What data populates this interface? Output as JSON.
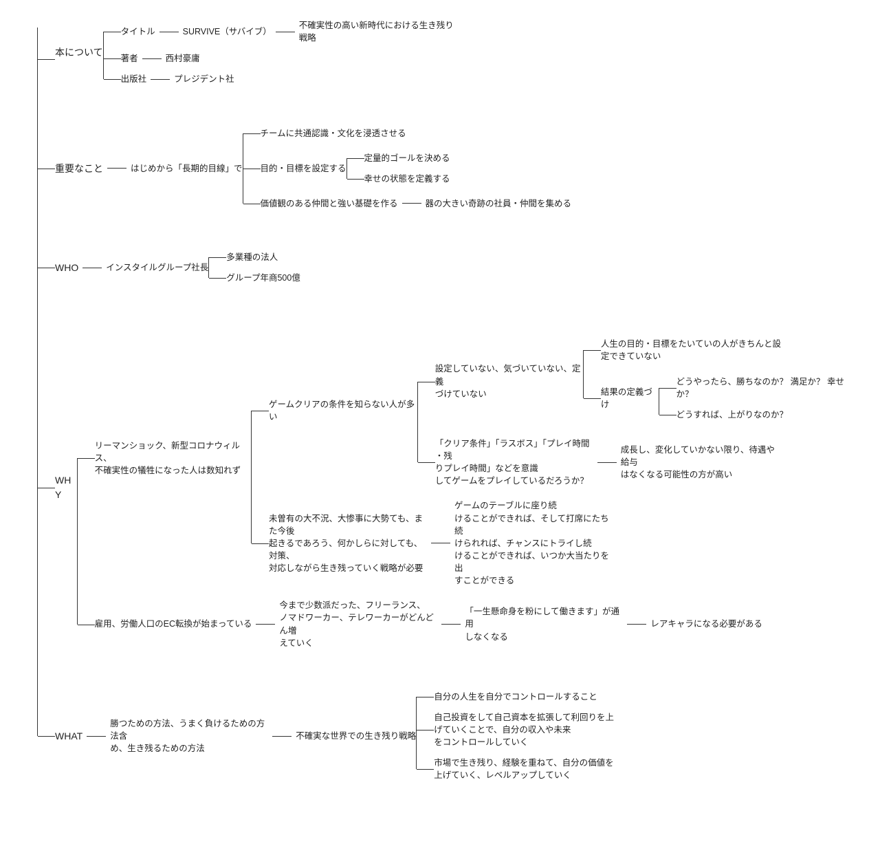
{
  "about": {
    "label": "本について",
    "title": {
      "k": "タイトル",
      "v": "SURVIVE（サバイブ）",
      "sub": "不確実性の高い新時代における生き残り戦略"
    },
    "author": {
      "k": "著者",
      "v": "西村豪庸"
    },
    "publisher": {
      "k": "出版社",
      "v": "プレジデント社"
    }
  },
  "important": {
    "label": "重要なこと",
    "stem": "はじめから「長期的目線」で",
    "a": "チームに共通認識・文化を浸透させる",
    "b": {
      "label": "目的・目標を設定する",
      "b1": "定量的ゴールを決める",
      "b2": "幸せの状態を定義する"
    },
    "c": {
      "label": "価値観のある仲間と強い基礎を作る",
      "c1": "器の大きい奇跡の社員・仲間を集める"
    }
  },
  "who": {
    "label": "WHO",
    "stem": "インスタイルグループ社長",
    "a": "多業種の法人",
    "b": "グループ年商500億"
  },
  "why": {
    "label": "WHY",
    "branch1": {
      "stem": "リーマンショック、新型コロナウィルス、\n不確実性の犠牲になった人は数知れず",
      "g": {
        "label": "ゲームクリアの条件を知らない人が多い",
        "g1": {
          "label": "設定していない、気づいていない、定義\nづけていない",
          "p1": "人生の目的・目標をたいていの人がきちんと設\n定できていない",
          "p2": {
            "label": "結果の定義づけ",
            "q1": "どうやったら、勝ちなのか？ 満足か？ 幸せか？",
            "q2": "どうすれば、上がりなのか？"
          }
        },
        "g2": {
          "label": "「クリア条件」「ラスボス」「プレイ時間 ・残\nりプレイ時間」などを意識\nしてゲームをプレイしているだろうか？",
          "r": "成長し、変化していかない限り、待遇や給与\nはなくなる可能性の方が高い"
        }
      },
      "m": {
        "label": "未曽有の大不況、大惨事に大勢ても、また今後\n起きるであろう、何かしらに対しても、対策、\n対応しながら生き残っていく戦略が必要",
        "m1": "ゲームのテーブルに座り続\nけることができれば、そして打席にたち続\nけられれば、チャンスにトライし続\nけることができれば、いつか大当たりを出\nすことができる"
      }
    },
    "branch2": {
      "stem": "雇用、労働人口のEC転換が始まっている",
      "a": "今まで少数派だった、フリーランス、\nノマドワーカー、テレワーカーがどんどん増\nえていく",
      "b": "「一生懸命身を粉にして働きます」が通用\nしなくなる",
      "c": "レアキャラになる必要がある"
    }
  },
  "what": {
    "label": "WHAT",
    "stem": "勝つための方法、うまく負けるための方法含\nめ、生き残るための方法",
    "mid": "不確実な世界での生き残り戦略",
    "a": "自分の人生を自分でコントロールすること",
    "b": "自己投資をして自己資本を拡張して利回りを上\nげていくことで、自分の収入や未来\nをコントロールしていく",
    "c": "市場で生き残り、経験を重ねて、自分の価値を\n上げていく、レベルアップしていく"
  }
}
